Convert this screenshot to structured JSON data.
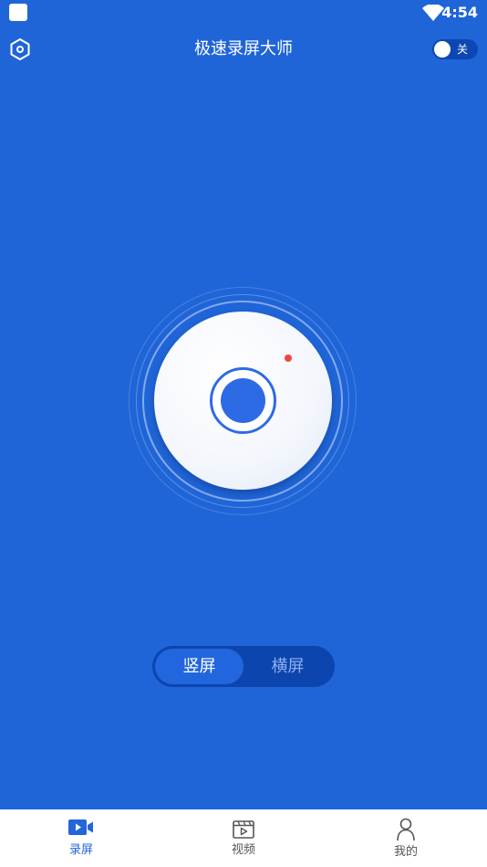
{
  "status_bar": {
    "time": "4:54",
    "icons": [
      "app-notification-icon",
      "wifi-icon"
    ]
  },
  "header": {
    "title": "极速录屏大师",
    "settings_icon": "hexagon-gear-icon",
    "toggle_label": "关",
    "toggle_state": "off"
  },
  "record": {
    "icon": "record-icon"
  },
  "orientation": {
    "portrait_label": "竖屏",
    "landscape_label": "横屏",
    "selected": "portrait"
  },
  "nav": {
    "items": [
      {
        "label": "录屏",
        "icon": "video-camera-icon",
        "active": true
      },
      {
        "label": "视频",
        "icon": "video-clapper-icon",
        "active": false
      },
      {
        "label": "我的",
        "icon": "user-icon",
        "active": false
      }
    ]
  },
  "colors": {
    "background": "#1f65d8",
    "accent": "#2366d8",
    "record_dot": "#f0463f"
  }
}
